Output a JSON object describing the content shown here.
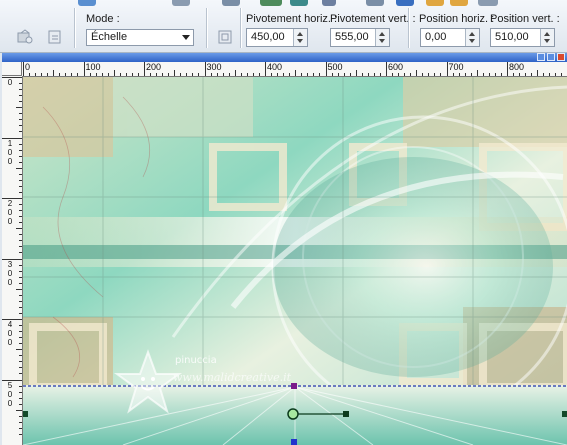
{
  "toolbar": {
    "mode_label": "Mode :",
    "mode_value": "Échelle",
    "pivot_h_label": "Pivotement horiz. :",
    "pivot_h_value": "450,00",
    "pivot_v_label": "Pivotement vert. :",
    "pivot_v_value": "555,00",
    "pos_h_label": "Position horiz. :",
    "pos_h_value": "0,00",
    "pos_v_label": "Position vert. :",
    "pos_v_value": "510,00"
  },
  "ruler": {
    "top_labels": [
      "0",
      "100",
      "200",
      "300",
      "400",
      "500",
      "600",
      "700",
      "800"
    ],
    "left_labels": [
      [
        "0"
      ],
      [
        "1",
        "0",
        "0"
      ],
      [
        "2",
        "0",
        "0"
      ],
      [
        "3",
        "0",
        "0"
      ],
      [
        "4",
        "0",
        "0"
      ],
      [
        "5",
        "0",
        "0"
      ]
    ]
  },
  "watermark": {
    "brand": "pinuccia",
    "url": "www.malidcreative.it"
  },
  "colors": {
    "window_frame": "#3a6fd0",
    "canvas_teal": "#7fd3bd",
    "canvas_cream": "#efe0b8",
    "canvas_tan": "#c8a87a"
  }
}
